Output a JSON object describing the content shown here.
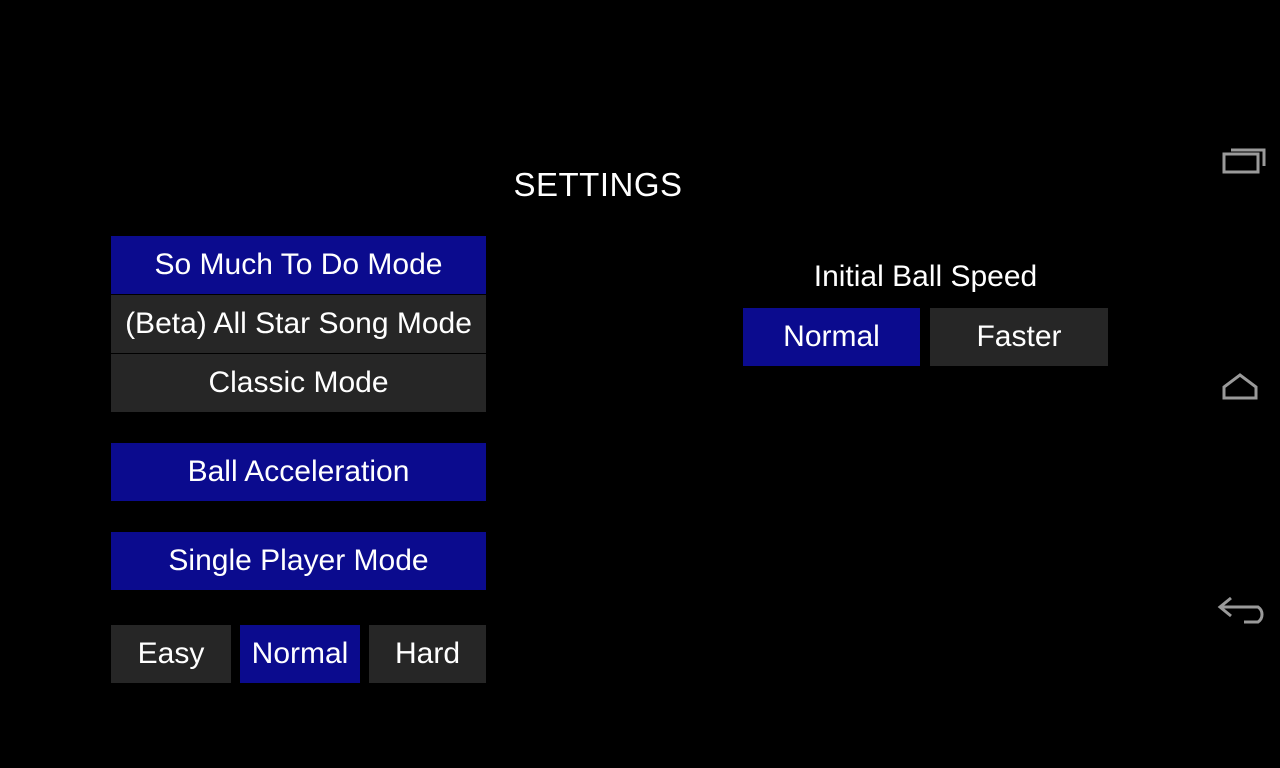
{
  "screen": {
    "title": "SETTINGS",
    "background_color": "#000000"
  },
  "theme": {
    "selected_color": "#0b0b8e",
    "unselected_color": "#262626",
    "text_color": "#ffffff",
    "nav_icon_color": "#9a9a9a"
  },
  "left_column": {
    "game_modes": [
      {
        "label": "So Much To Do Mode",
        "selected": true
      },
      {
        "label": "(Beta) All Star Song Mode",
        "selected": false
      },
      {
        "label": "Classic Mode",
        "selected": false
      }
    ],
    "ball_acceleration": {
      "label": "Ball Acceleration",
      "selected": true
    },
    "player_mode": {
      "label": "Single Player Mode",
      "selected": true
    },
    "difficulty": [
      {
        "label": "Easy",
        "selected": false
      },
      {
        "label": "Normal",
        "selected": true
      },
      {
        "label": "Hard",
        "selected": false
      }
    ]
  },
  "right_column": {
    "ball_speed": {
      "label": "Initial Ball Speed",
      "options": [
        {
          "label": "Normal",
          "selected": true
        },
        {
          "label": "Faster",
          "selected": false
        }
      ]
    }
  },
  "nav_bar": {
    "keys": [
      {
        "name": "recents",
        "icon": "recent-apps-icon"
      },
      {
        "name": "home",
        "icon": "home-icon"
      },
      {
        "name": "back",
        "icon": "back-arrow-icon"
      }
    ]
  }
}
